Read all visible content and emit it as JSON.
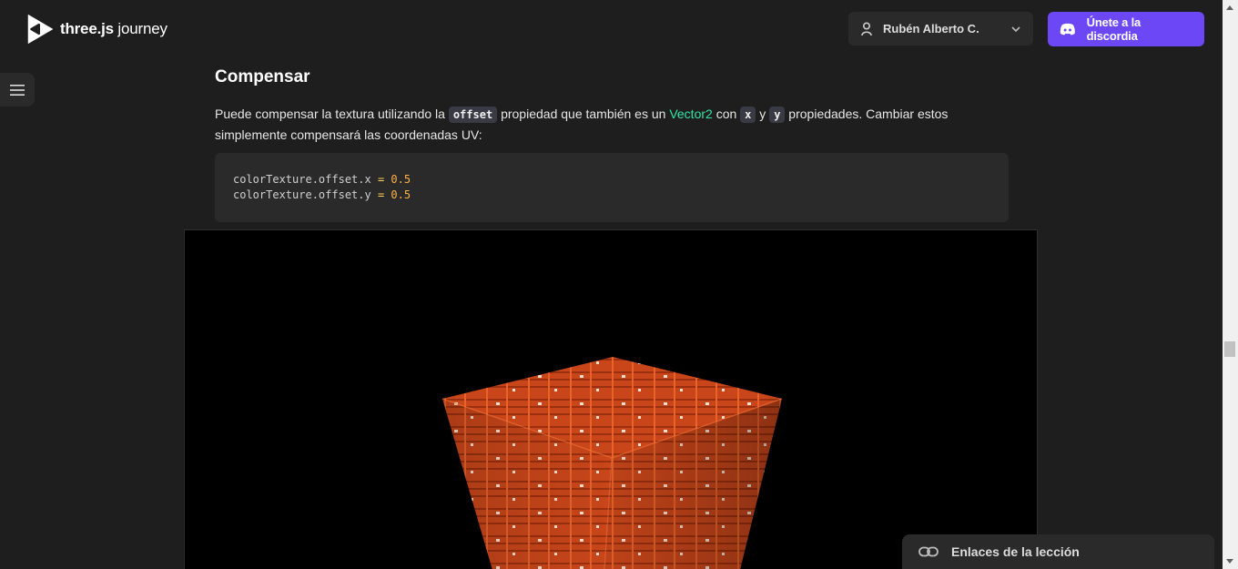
{
  "header": {
    "logo_bold": "three.js",
    "logo_light": " journey",
    "user_name": "Rubén Alberto C.",
    "discord_label": "Únete a la discordia"
  },
  "section": {
    "title": "Compensar",
    "text_1": "Puede compensar la textura utilizando la ",
    "code_offset": "offset",
    "text_2": " propiedad que también es un ",
    "link_vector2": "Vector2",
    "text_3": " con ",
    "code_x": "x",
    "text_4": " y ",
    "code_y": "y",
    "text_5": " propiedades. Cambiar estos simplemente compensará las coordenadas UV:"
  },
  "code": {
    "line1_prop": "colorTexture.offset.x",
    "line1_op": " = ",
    "line1_val": "0.5",
    "line2_prop": "colorTexture.offset.y",
    "line2_op": " = ",
    "line2_val": "0.5"
  },
  "links_panel": {
    "label": "Enlaces de la lección"
  },
  "icons": {
    "logo": "threejs-logo-icon",
    "user": "user-icon",
    "chevron": "chevron-down-icon",
    "discord": "discord-icon",
    "menu": "hamburger-menu-icon",
    "link": "link-icon"
  },
  "colors": {
    "accent": "#6b47f5",
    "link_green": "#2ee6a6",
    "cube_orange": "#d4501a"
  }
}
